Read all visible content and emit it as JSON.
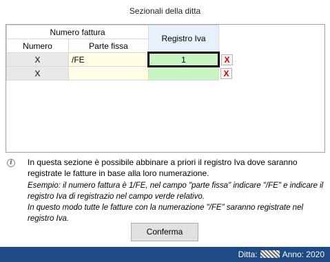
{
  "window": {
    "title": "Sezionali della ditta"
  },
  "grid": {
    "header_group": "Numero fattura",
    "header_registro": "Registro Iva",
    "col_numero": "Numero",
    "col_parte_fissa": "Parte fissa",
    "rows": [
      {
        "numero": "X",
        "parte_fissa": "/FE",
        "registro": "1",
        "delete": "X"
      },
      {
        "numero": "X",
        "parte_fissa": "",
        "registro": "",
        "delete": "X"
      }
    ]
  },
  "info": {
    "icon": "info-icon",
    "text": "In questa sezione è possibile abbinare a priori il registro Iva dove saranno registrate le fatture in base alla loro numerazione.",
    "example_1": "Esempio: il numero fattura è 1/FE, nel campo \"parte fissa\" indicare \"/FE\" e indicare il registro Iva di registrazio nel campo verde relativo.",
    "example_2": "In questo modo tutte le fatture con la numerazione \"/FE\" saranno registrate nel registro Iva."
  },
  "buttons": {
    "confirm_label": "Conferma"
  },
  "status": {
    "ditta_label": "Ditta:",
    "anno_label": "Anno:",
    "anno_value": "2020"
  },
  "colors": {
    "status_bar": "#1e4a86",
    "registro_header": "#e6f1fb",
    "registro_cell": "#c8f5c3",
    "parte_fissa_cell": "#fffde6",
    "delete_x": "#d00000"
  }
}
